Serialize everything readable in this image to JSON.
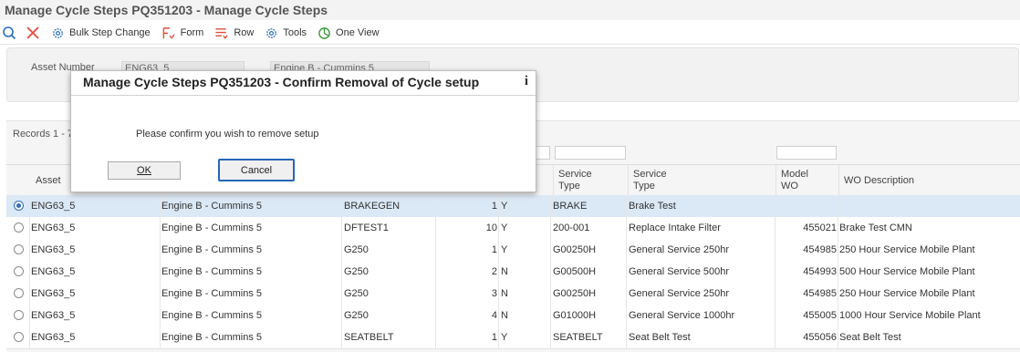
{
  "page_title": "Manage Cycle Steps PQ351203 - Manage Cycle Steps",
  "toolbar": {
    "bulk_step_change": "Bulk Step Change",
    "form": "Form",
    "row": "Row",
    "tools": "Tools",
    "one_view": "One View"
  },
  "header": {
    "asset_number_label": "Asset Number",
    "asset_number_value": "ENG63_5",
    "asset_description": "Engine B - Cummins 5"
  },
  "grid": {
    "records": "Records 1 - 7",
    "columns": {
      "asset": "Asset",
      "service_type_1": "Service",
      "service_type_2": "Type",
      "service_desc_1": "Service",
      "service_desc_2": "Type",
      "model_wo_1": "Model",
      "model_wo_2": "WO",
      "wo_description": "WO Description"
    },
    "rows": [
      {
        "asset": "ENG63_5",
        "desc": "Engine B - Cummins 5",
        "group": "BRAKEGEN",
        "seq": "1",
        "flag": "Y",
        "stype": "BRAKE",
        "sdesc": "Brake Test",
        "model": "",
        "wo": ""
      },
      {
        "asset": "ENG63_5",
        "desc": "Engine B - Cummins 5",
        "group": "DFTEST1",
        "seq": "10",
        "flag": "Y",
        "stype": "200-001",
        "sdesc": "Replace Intake Filter",
        "model": "455021",
        "wo": "Brake Test CMN"
      },
      {
        "asset": "ENG63_5",
        "desc": "Engine B - Cummins 5",
        "group": "G250",
        "seq": "1",
        "flag": "Y",
        "stype": "G00250H",
        "sdesc": "General Service 250hr",
        "model": "454985",
        "wo": "250 Hour Service Mobile Plant"
      },
      {
        "asset": "ENG63_5",
        "desc": "Engine B - Cummins 5",
        "group": "G250",
        "seq": "2",
        "flag": "N",
        "stype": "G00500H",
        "sdesc": "General Service 500hr",
        "model": "454993",
        "wo": "500 Hour Service Mobile Plant"
      },
      {
        "asset": "ENG63_5",
        "desc": "Engine B - Cummins 5",
        "group": "G250",
        "seq": "3",
        "flag": "N",
        "stype": "G00250H",
        "sdesc": "General Service 250hr",
        "model": "454985",
        "wo": "250 Hour Service Mobile Plant"
      },
      {
        "asset": "ENG63_5",
        "desc": "Engine B - Cummins 5",
        "group": "G250",
        "seq": "4",
        "flag": "N",
        "stype": "G01000H",
        "sdesc": "General Service 1000hr",
        "model": "455005",
        "wo": "1000 Hour Service Mobile Plant"
      },
      {
        "asset": "ENG63_5",
        "desc": "Engine B - Cummins 5",
        "group": "SEATBELT",
        "seq": "1",
        "flag": "Y",
        "stype": "SEATBELT",
        "sdesc": "Seat Belt Test",
        "model": "455056",
        "wo": "Seat Belt Test"
      }
    ]
  },
  "dialog": {
    "title": "Manage Cycle Steps PQ351203 - Confirm Removal of Cycle setup",
    "info": "i",
    "message": "Please confirm you wish to remove setup",
    "ok": "OK",
    "cancel": "Cancel"
  },
  "colors": {
    "selected_row": "#dbe9f6",
    "focus_border": "#2566b8",
    "icon_blue": "#2c6fba",
    "icon_red": "#e24b3b",
    "icon_green": "#3a9a3a"
  }
}
